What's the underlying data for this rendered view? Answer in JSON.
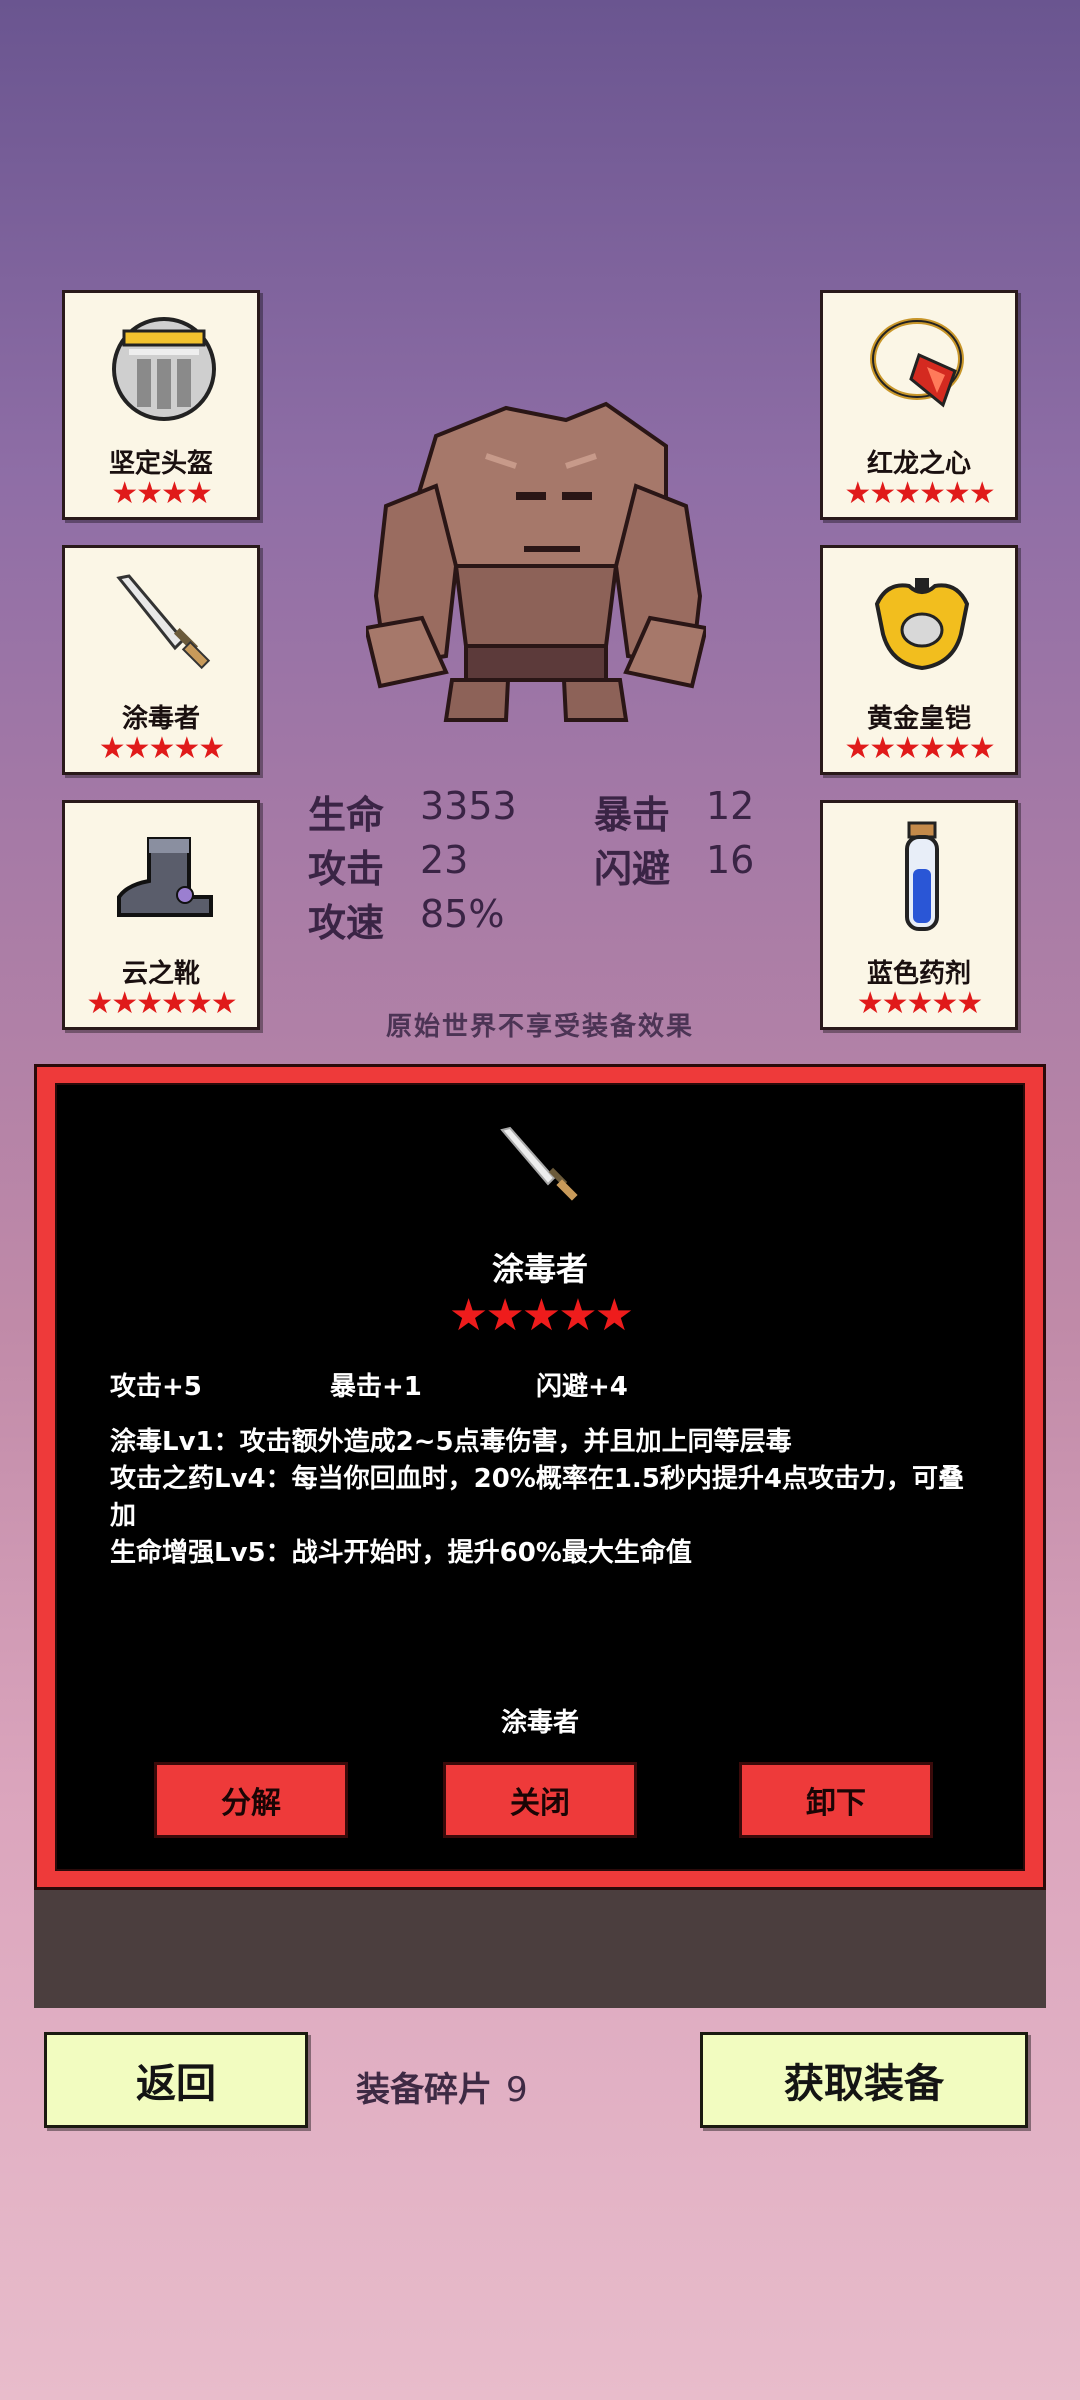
{
  "equipment_left": [
    {
      "name": "坚定头盔",
      "stars": "★★★★",
      "icon": "helmet-icon"
    },
    {
      "name": "涂毒者",
      "stars": "★★★★★",
      "icon": "dagger-icon"
    },
    {
      "name": "云之靴",
      "stars": "★★★★★★",
      "icon": "boots-icon"
    }
  ],
  "equipment_right": [
    {
      "name": "红龙之心",
      "stars": "★★★★★★",
      "icon": "amulet-icon"
    },
    {
      "name": "黄金皇铠",
      "stars": "★★★★★★",
      "icon": "gold-armor-icon"
    },
    {
      "name": "蓝色药剂",
      "stars": "★★★★★",
      "icon": "potion-icon"
    }
  ],
  "character": {
    "icon": "rock-golem-icon"
  },
  "stats": {
    "hp_label": "生命",
    "hp": "3353",
    "atk_label": "攻击",
    "atk": "23",
    "aspd_label": "攻速",
    "aspd": "85%",
    "crit_label": "暴击",
    "crit": "12",
    "dodge_label": "闪避",
    "dodge": "16"
  },
  "note": "原始世界不享受装备效果",
  "detail": {
    "icon": "dagger-icon",
    "name": "涂毒者",
    "stars": "★★★★★",
    "attrs": [
      "攻击+5",
      "暴击+1",
      "闪避+4"
    ],
    "desc": [
      "涂毒Lv1：攻击额外造成2~5点毒伤害，并且加上同等层毒",
      "攻击之药Lv4：每当你回血时，20%概率在1.5秒内提升4点攻击力，可叠加",
      "生命增强Lv5：战斗开始时，提升60%最大生命值"
    ],
    "footer": "涂毒者",
    "buttons": {
      "decompose": "分解",
      "close": "关闭",
      "unequip": "卸下"
    }
  },
  "bottom": {
    "back": "返回",
    "fragments_label": "装备碎片",
    "fragments_value": "9",
    "get_equipment": "获取装备"
  },
  "colors": {
    "panel_red": "#ee3a3a",
    "star_red": "#e01a1a",
    "button_yellow": "#f2fcc0"
  }
}
